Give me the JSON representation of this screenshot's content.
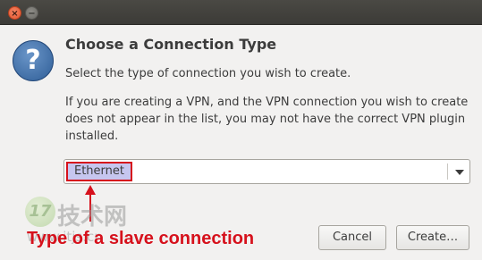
{
  "window": {
    "close_glyph": "×",
    "minimize_glyph": "−"
  },
  "dialog": {
    "icon_glyph": "?",
    "heading": "Choose a Connection Type",
    "subtext": "Select the type of connection you wish to create.",
    "description": "If you are creating a VPN, and the VPN connection you wish to create does not appear in the list, you may not have the correct VPN plugin installed.",
    "connection_type": {
      "selected": "Ethernet"
    },
    "buttons": {
      "cancel": "Cancel",
      "create": "Create…"
    }
  },
  "annotation": {
    "text": "Type of a slave connection",
    "color": "#d6111c"
  },
  "watermark": {
    "badge": "17",
    "chinese": "技术网",
    "url": "www.itjs.cn"
  },
  "colors": {
    "selection_highlight": "#c6c6ef",
    "icon_blue": "#2f5e97"
  }
}
